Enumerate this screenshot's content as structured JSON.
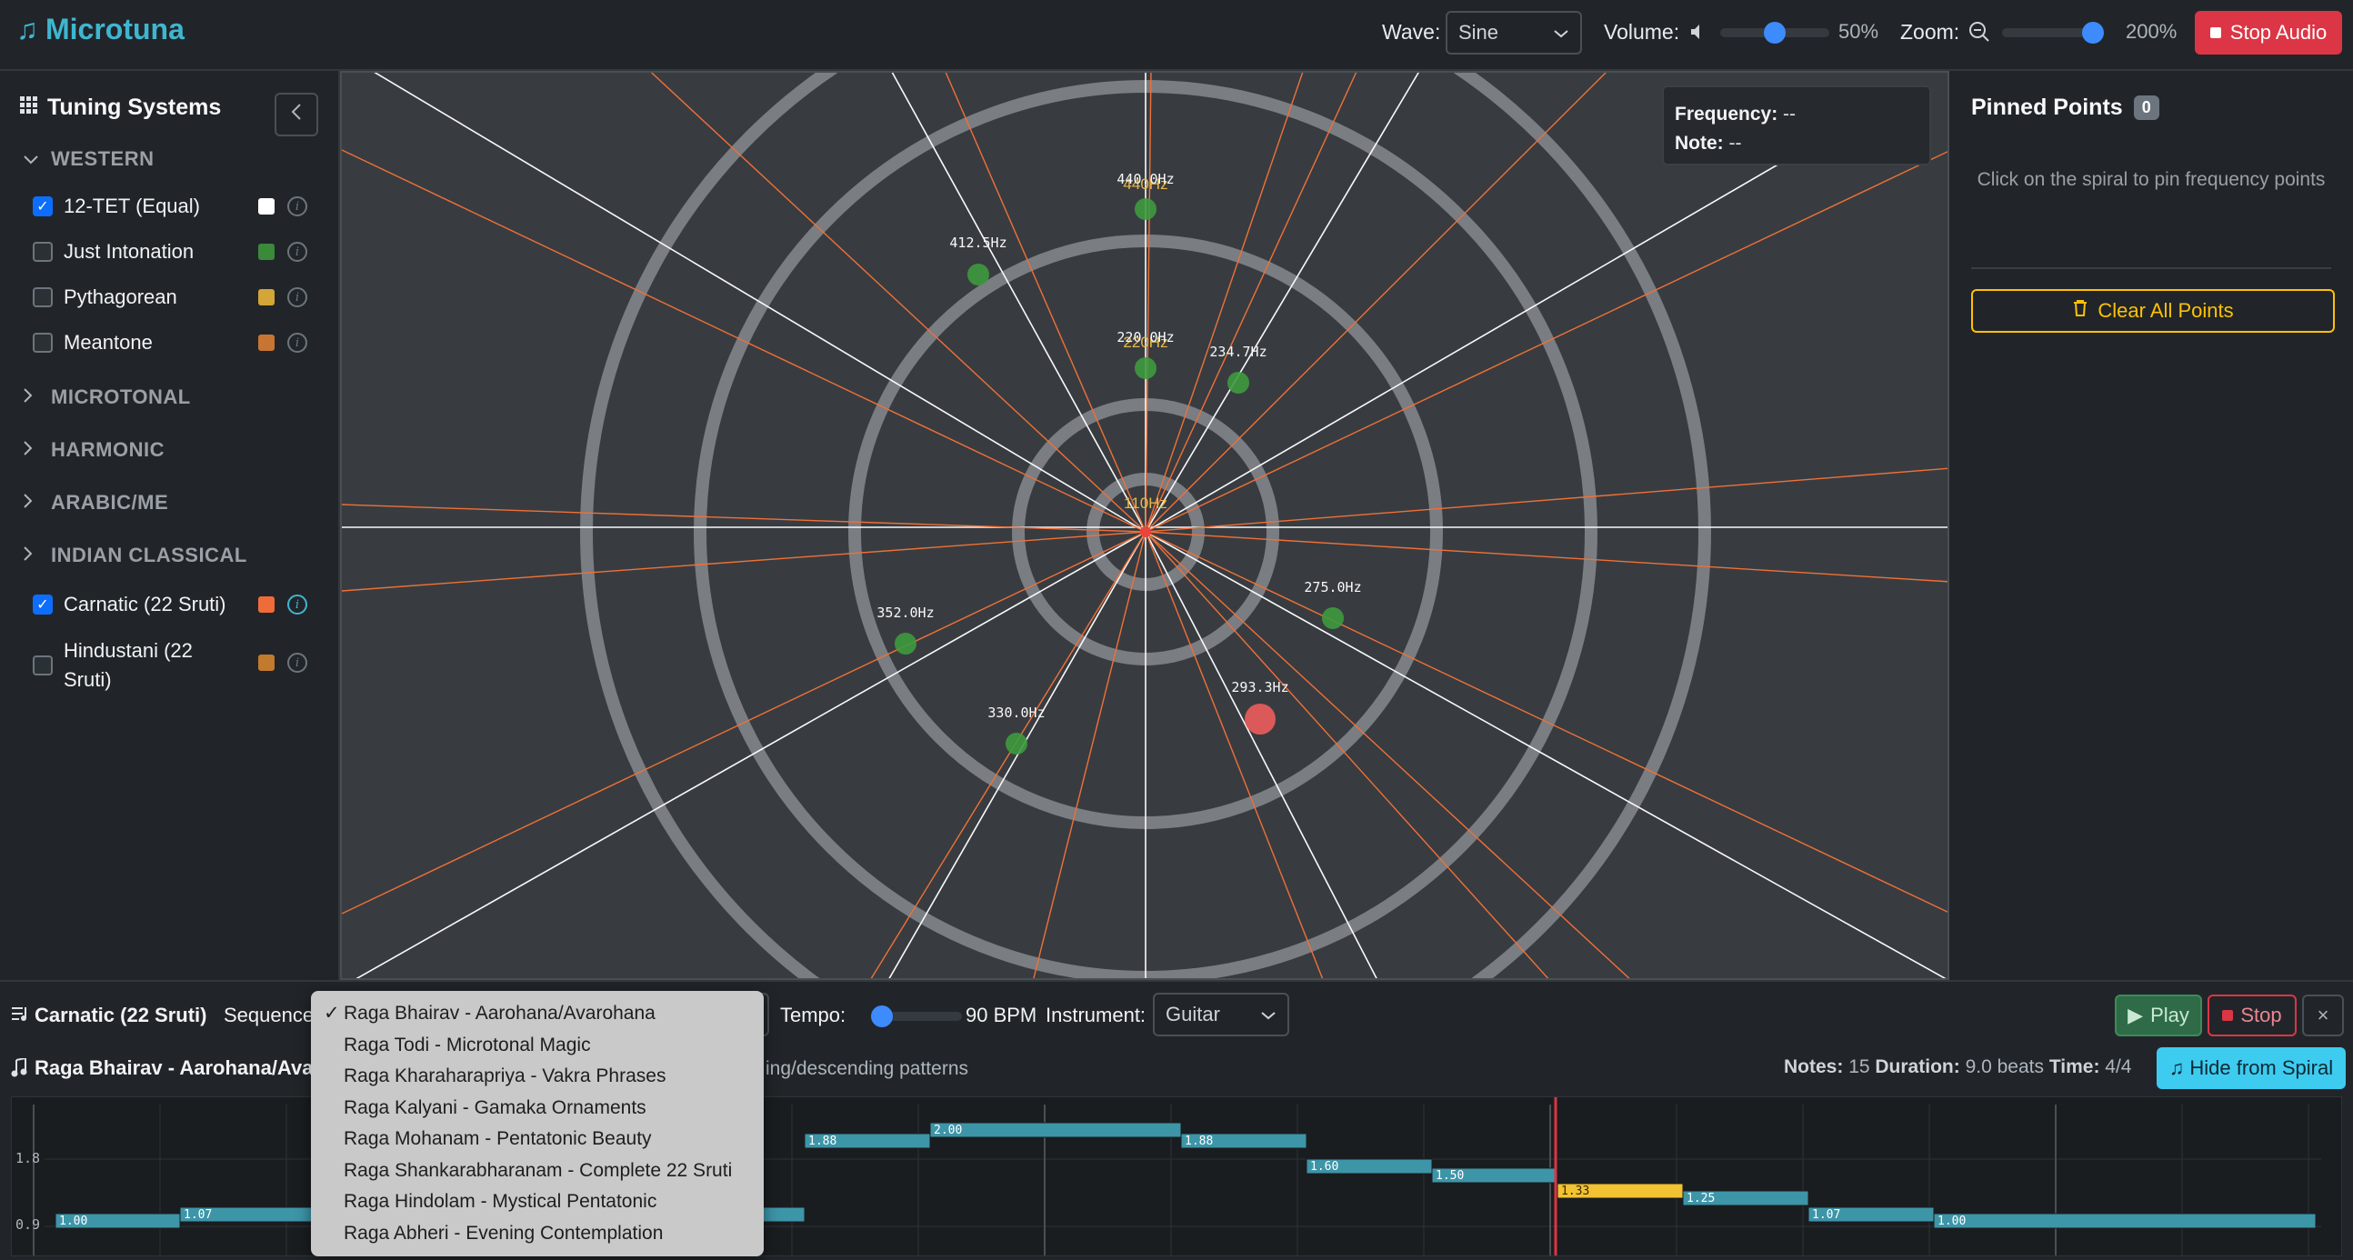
{
  "app": {
    "title": "Microtuna"
  },
  "topbar": {
    "wave_label": "Wave:",
    "wave_value": "Sine",
    "volume_label": "Volume:",
    "volume_value": "50%",
    "volume_level": 0.5,
    "zoom_label": "Zoom:",
    "zoom_value": "200%",
    "zoom_level": 1.0,
    "stop_audio_label": "Stop Audio"
  },
  "sidebar": {
    "title": "Tuning Systems",
    "categories": [
      {
        "label": "WESTERN",
        "expanded": true
      },
      {
        "label": "MICROTONAL",
        "expanded": false
      },
      {
        "label": "HARMONIC",
        "expanded": false
      },
      {
        "label": "ARABIC/ME",
        "expanded": false
      },
      {
        "label": "INDIAN CLASSICAL",
        "expanded": true
      }
    ],
    "western_items": [
      {
        "label": "12-TET (Equal)",
        "checked": true,
        "color": "#ffffff"
      },
      {
        "label": "Just Intonation",
        "checked": false,
        "color": "#3a8a3a"
      },
      {
        "label": "Pythagorean",
        "checked": false,
        "color": "#d4a537"
      },
      {
        "label": "Meantone",
        "checked": false,
        "color": "#c87533"
      }
    ],
    "indian_items": [
      {
        "label": "Carnatic (22 Sruti)",
        "checked": true,
        "color": "#f06b3a"
      },
      {
        "label": "Hindustani (22 Sruti)",
        "checked": false,
        "color": "#c27a2e"
      }
    ]
  },
  "readout": {
    "frequency_label": "Frequency:",
    "frequency_value": "--",
    "note_label": "Note:",
    "note_value": "--"
  },
  "spiral": {
    "ring_labels": [
      "440Hz",
      "220Hz",
      "110Hz"
    ],
    "points": [
      {
        "label": "440.0Hz"
      },
      {
        "label": "412.5Hz"
      },
      {
        "label": "220.0Hz"
      },
      {
        "label": "234.7Hz"
      },
      {
        "label": "275.0Hz"
      },
      {
        "label": "293.3Hz",
        "active": true
      },
      {
        "label": "352.0Hz"
      },
      {
        "label": "330.0Hz"
      }
    ]
  },
  "pinned": {
    "title": "Pinned Points",
    "count": "0",
    "hint": "Click on the spiral to pin frequency points",
    "clear_label": "Clear All Points"
  },
  "sequencer": {
    "system_label": "Carnatic (22 Sruti)",
    "sequence_label": "Sequence",
    "tempo_label": "Tempo:",
    "tempo_value": "90 BPM",
    "instrument_label": "Instrument:",
    "instrument_value": "Guitar",
    "play_label": "Play",
    "stop_label": "Stop",
    "close_label": "×",
    "current_title": "Raga Bhairav - Aarohana/Avaro",
    "description_tail": "ing/descending patterns",
    "notes_label": "Notes:",
    "notes_value": "15",
    "duration_label": "Duration:",
    "duration_value": "9.0 beats",
    "time_label": "Time:",
    "time_value": "4/4",
    "hide_label": "Hide from Spiral",
    "options": [
      "Raga Bhairav - Aarohana/Avarohana",
      "Raga Todi - Microtonal Magic",
      "Raga Kharaharapriya - Vakra Phrases",
      "Raga Kalyani - Gamaka Ornaments",
      "Raga Mohanam - Pentatonic Beauty",
      "Raga Shankarabharanam - Complete 22 Sruti",
      "Raga Hindolam - Mystical Pentatonic",
      "Raga Abheri - Evening Contemplation"
    ],
    "selected_index": 0,
    "roll_y_labels": [
      "1.8",
      "0.9"
    ],
    "notes": [
      {
        "ratio": "1.00",
        "value": 1.0,
        "beats": 1
      },
      {
        "ratio": "1.07",
        "value": 1.07,
        "beats": 1
      },
      {
        "ratio": "1.88",
        "value": 1.88,
        "beats": 1
      },
      {
        "ratio": "2.00",
        "value": 2.0,
        "beats": 2
      },
      {
        "ratio": "1.88",
        "value": 1.88,
        "beats": 1
      },
      {
        "ratio": "1.60",
        "value": 1.6,
        "beats": 1
      },
      {
        "ratio": "1.50",
        "value": 1.5,
        "beats": 1
      },
      {
        "ratio": "1.33",
        "value": 1.33,
        "beats": 1,
        "active": true
      },
      {
        "ratio": "1.25",
        "value": 1.25,
        "beats": 1
      },
      {
        "ratio": "1.07",
        "value": 1.07,
        "beats": 1
      },
      {
        "ratio": "1.00",
        "value": 1.0,
        "beats": 3
      }
    ]
  },
  "colors": {
    "accent": "#3fb6d0",
    "danger": "#dc3545",
    "warning": "#ffc107",
    "note_bar": "#3d95a8",
    "note_active": "#f1c232"
  }
}
